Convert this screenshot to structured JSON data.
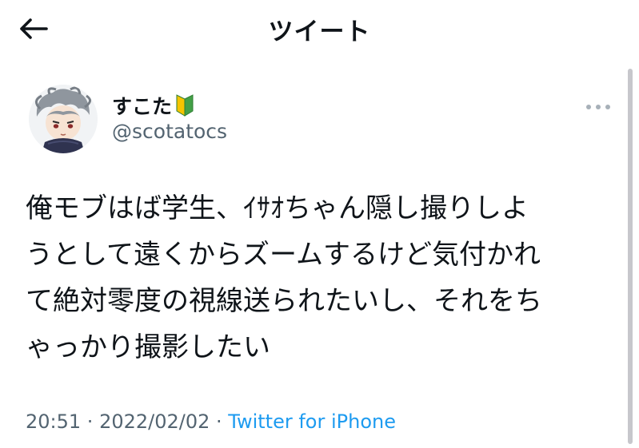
{
  "header": {
    "title": "ツイート",
    "back_icon": "arrow-left-icon"
  },
  "author": {
    "display_name": "すこた",
    "badge_icon": "beginner-mark-icon",
    "username": "@scotatocs",
    "avatar_icon": "avatar-image"
  },
  "tweet": {
    "lines": [
      "俺モブはば学生、ｲｻｵちゃん隠し撮りしよ",
      "うとして遠くからズームするけど気付かれ",
      "て絶対零度の視線送られたいし、それをち",
      "ゃっかり撮影したい"
    ]
  },
  "meta": {
    "time": "20:51",
    "separator": " · ",
    "date": "2022/02/02",
    "source": "Twitter for iPhone"
  },
  "colors": {
    "text": "#0f1419",
    "secondary": "#536471",
    "link": "#1d9bf0",
    "background": "#ffffff"
  }
}
